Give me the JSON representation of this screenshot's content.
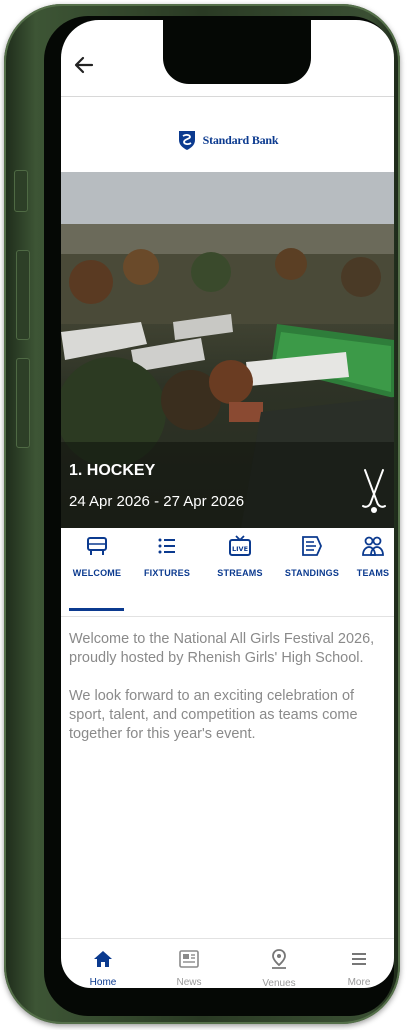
{
  "app": {
    "brand": "Standard Bank",
    "accent": "#0b3a8f"
  },
  "hero": {
    "title": "1. HOCKEY",
    "date_range": "24 Apr 2026 - 27 Apr 2026",
    "sport_icon": "hockey-sticks-icon"
  },
  "tabs": [
    {
      "label": "WELCOME",
      "icon": "goal-icon",
      "active": true
    },
    {
      "label": "FIXTURES",
      "icon": "list-icon"
    },
    {
      "label": "STREAMS",
      "icon": "live-tv-icon"
    },
    {
      "label": "STANDINGS",
      "icon": "standings-icon"
    },
    {
      "label": "TEAMS",
      "icon": "teams-icon"
    }
  ],
  "content": {
    "paragraph1": "Welcome to the National All Girls Festival 2026, proudly hosted by Rhenish Girls' High School.",
    "paragraph2": "We look forward to an exciting celebration of sport, talent, and competition as teams come together for this year's event."
  },
  "bottom_nav": [
    {
      "label": "Home",
      "icon": "home-icon",
      "active": true
    },
    {
      "label": "News",
      "icon": "news-icon"
    },
    {
      "label": "Venues",
      "icon": "location-pin-icon"
    },
    {
      "label": "More",
      "icon": "menu-icon"
    }
  ]
}
